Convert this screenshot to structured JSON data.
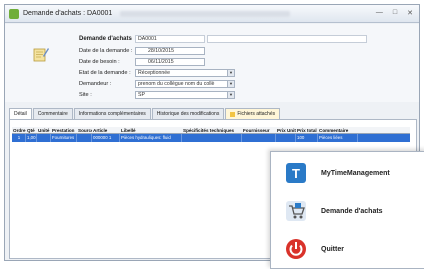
{
  "window": {
    "title": "Demande d'achats : DA0001"
  },
  "header": {
    "section_label": "Demande d'achats",
    "number": "DA0001",
    "fields": [
      {
        "label": "Date de la demande :",
        "value": "28/10/2015"
      },
      {
        "label": "Date de besoin :",
        "value": "06/11/2015"
      },
      {
        "label": "Etat de la demande :",
        "value": "Réceptionnée"
      },
      {
        "label": "Demandeur :",
        "value": "prenom du collègue nom du collè"
      },
      {
        "label": "Site :",
        "value": "SP"
      }
    ]
  },
  "tabs": [
    {
      "label": "Détail"
    },
    {
      "label": "Commentaire"
    },
    {
      "label": "Informations complémentaires"
    },
    {
      "label": "Historique des modifications"
    },
    {
      "label": "Fichiers attachés"
    }
  ],
  "grid": {
    "columns": [
      "Ordre",
      "Qté",
      "Unité",
      "Prestation",
      "Source",
      "Article",
      "Libellé",
      "Spécificités techniques",
      "Fournisseur",
      "Prix Unit",
      "Prix total",
      "Commentaire"
    ],
    "row": [
      "1",
      "1,00",
      "",
      "Fournitures",
      "",
      "000000 1",
      "Pièces hydrauliques: fluid",
      "",
      "",
      "",
      "100",
      "Pièces liées"
    ]
  },
  "popup_menu": {
    "items": [
      {
        "label": "MyTimeManagement",
        "icon": "clock-app-icon"
      },
      {
        "label": "Demande d'achats",
        "icon": "purchase-cart-icon"
      },
      {
        "label": "Quitter",
        "icon": "power-off-icon"
      }
    ]
  },
  "colors": {
    "selection": "#2f6fd3",
    "quit": "#d9322a",
    "app_blue": "#2a7ac7"
  }
}
